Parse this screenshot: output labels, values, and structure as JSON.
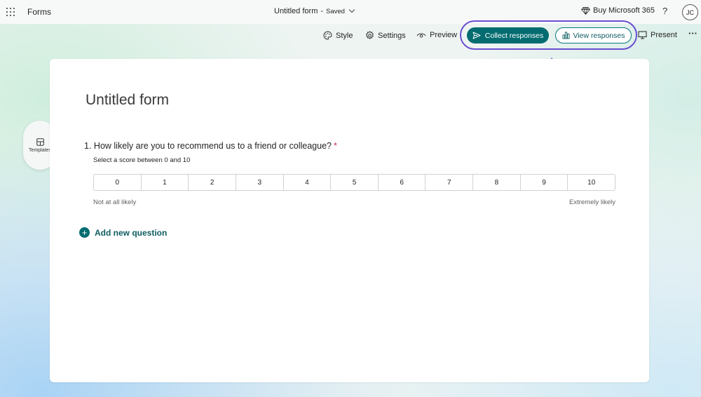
{
  "header": {
    "app_name": "Forms",
    "doc_title": "Untitled form",
    "separator": "-",
    "save_status": "Saved",
    "buy_label": "Buy Microsoft 365",
    "help_label": "?",
    "avatar_initials": "JC"
  },
  "toolbar": {
    "style_label": "Style",
    "settings_label": "Settings",
    "preview_label": "Preview",
    "collect_label": "Collect responses",
    "view_label": "View responses",
    "present_label": "Present",
    "more_label": "···"
  },
  "sidebar": {
    "templates_label": "Templates"
  },
  "form": {
    "title": "Untitled form",
    "questions": [
      {
        "number": "1.",
        "text": "How likely are you to recommend us to a friend or colleague?",
        "required_mark": "*",
        "subtitle": "Select a score between 0 and 10",
        "scale": [
          "0",
          "1",
          "2",
          "3",
          "4",
          "5",
          "6",
          "7",
          "8",
          "9",
          "10"
        ],
        "low_label": "Not at all likely",
        "high_label": "Extremely likely"
      }
    ],
    "add_question_label": "Add new question"
  },
  "colors": {
    "accent": "#036c70",
    "highlight": "#6b4fd1",
    "required": "#c4314b"
  }
}
